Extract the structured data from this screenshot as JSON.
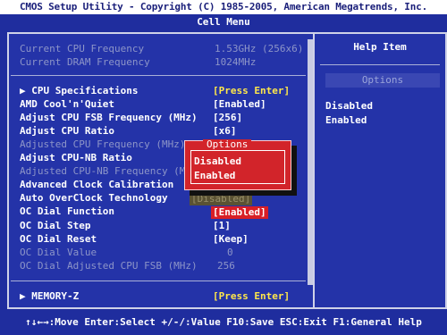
{
  "header": {
    "title": "CMOS Setup Utility - Copyright (C) 1985-2005, American Megatrends, Inc.",
    "subtitle": "Cell Menu"
  },
  "info": [
    {
      "label": "Current CPU Frequency",
      "value": "1.53GHz (256x6)"
    },
    {
      "label": "Current DRAM Frequency",
      "value": "1024MHz"
    }
  ],
  "items": [
    {
      "label": "▶ CPU Specifications",
      "value": "[Press Enter]"
    },
    {
      "label": "AMD Cool'n'Quiet",
      "value": "[Enabled]"
    },
    {
      "label": "Adjust CPU FSB Frequency (MHz)",
      "value": "[256]"
    },
    {
      "label": "Adjust CPU Ratio",
      "value": "[x6]"
    },
    {
      "label": "Adjusted CPU Frequency (MHz)",
      "value": ""
    },
    {
      "label": "Adjust CPU-NB Ratio",
      "value": ""
    },
    {
      "label": "Adjusted CPU-NB Frequency (M",
      "value": ""
    },
    {
      "label": "Advanced Clock Calibration",
      "value": ""
    },
    {
      "label": "Auto OverClock Technology",
      "value": "[Disabled]"
    },
    {
      "label": "OC Dial Function",
      "value": "[Enabled]"
    },
    {
      "label": "OC Dial Step",
      "value": "[1]"
    },
    {
      "label": "OC Dial Reset",
      "value": "[Keep]"
    },
    {
      "label": "OC Dial Value",
      "value": "0"
    },
    {
      "label": "OC Dial Adjusted CPU FSB (MHz)",
      "value": "256"
    }
  ],
  "memory": {
    "label": "▶ MEMORY-Z",
    "value": "[Press Enter]"
  },
  "popup": {
    "title": "Options",
    "options": [
      "Disabled",
      "Enabled"
    ],
    "selected": "Enabled"
  },
  "help": {
    "title": "Help Item",
    "options_label": "Options",
    "options": [
      "Disabled",
      "Enabled"
    ]
  },
  "footer": "↑↓←→:Move  Enter:Select  +/-/:Value  F10:Save  ESC:Exit  F1:General Help",
  "colors": {
    "background": "#1f2d9e",
    "highlight": "#d81f26",
    "submenu_text": "#ffe84a"
  }
}
